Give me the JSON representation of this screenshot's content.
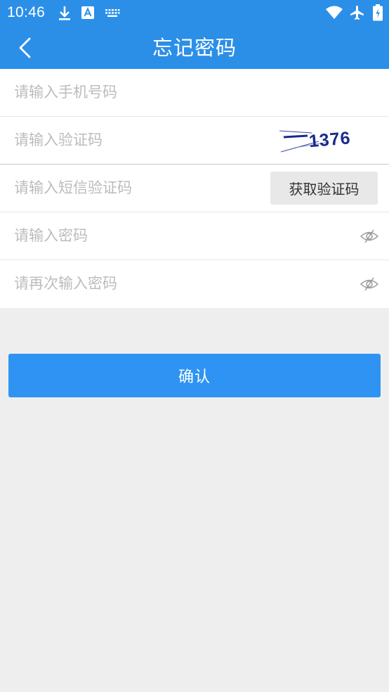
{
  "status_bar": {
    "time": "10:46",
    "icons": [
      "download-icon",
      "a-notification-icon",
      "keyboard-icon",
      "wifi-icon",
      "airplane-mode-icon",
      "battery-icon"
    ]
  },
  "app_bar": {
    "back_icon": "chevron-left-icon",
    "title": "忘记密码"
  },
  "form": {
    "phone_placeholder": "请输入手机号码",
    "captcha_placeholder": "请输入验证码",
    "captcha_text": "1376",
    "sms_placeholder": "请输入短信验证码",
    "sms_button_label": "获取验证码",
    "password_placeholder": "请输入密码",
    "confirm_password_placeholder": "请再次输入密码",
    "eye_icon": "eye-hidden-icon"
  },
  "confirm_button_label": "确认",
  "colors": {
    "primary": "#2b8fe8",
    "button": "#2f93f3",
    "background": "#eeeeee",
    "placeholder": "#bcbcbc",
    "captcha": "#1a2a8c"
  }
}
